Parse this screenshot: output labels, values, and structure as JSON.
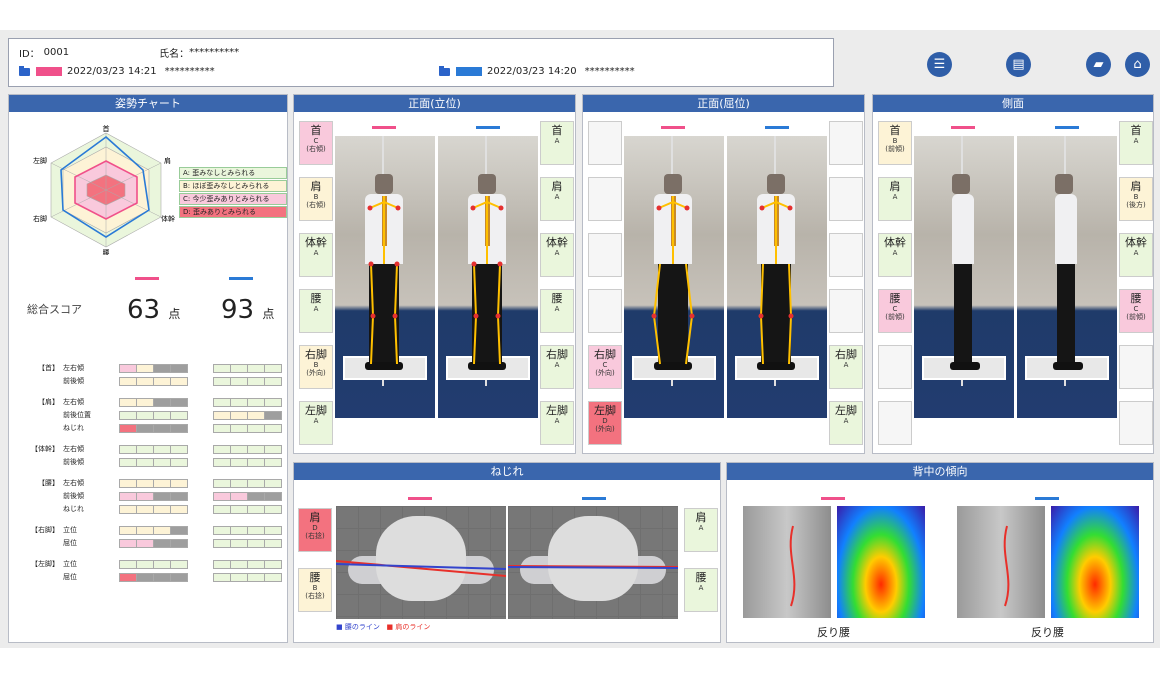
{
  "header": {
    "id_label": "ID：",
    "id_value": "0001",
    "name_label": "氏名：",
    "name_value": "**********",
    "session_a": {
      "date": "2022/03/23 14:21",
      "name": "**********",
      "color": "#f0508a"
    },
    "session_b": {
      "date": "2022/03/23 14:20",
      "name": "**********",
      "color": "#2a7ad6"
    }
  },
  "toolbar": {
    "report_icon": "report-icon",
    "print_icon": "print-icon",
    "folder_icon": "folder-icon",
    "home_icon": "home-icon"
  },
  "posture_chart": {
    "title": "姿勢チャート",
    "axes": [
      "首",
      "肩",
      "体幹",
      "腰",
      "右脚",
      "左脚"
    ],
    "legend": [
      "A: 歪みなしとみられる",
      "B: ほぼ歪みなしとみられる",
      "C: 今少歪みありとみられる",
      "D: 歪みありとみられる"
    ],
    "score_label": "総合スコア",
    "score_a": "63",
    "score_b": "93",
    "unit": "点",
    "groups": [
      {
        "cat": "【首】",
        "rows": [
          "左右傾",
          "前後傾"
        ]
      },
      {
        "cat": "【肩】",
        "rows": [
          "左右傾",
          "前後位置",
          "ねじれ"
        ]
      },
      {
        "cat": "【体幹】",
        "rows": [
          "左右傾",
          "前後傾"
        ]
      },
      {
        "cat": "【腰】",
        "rows": [
          "左右傾",
          "前後傾",
          "ねじれ"
        ]
      },
      {
        "cat": "【右脚】",
        "rows": [
          "立位",
          "屈位"
        ]
      },
      {
        "cat": "【左脚】",
        "rows": [
          "立位",
          "屈位"
        ]
      }
    ]
  },
  "front_standing": {
    "title": "正面(立位)",
    "left": [
      {
        "label": "首",
        "grade": "C",
        "note": "(右傾)"
      },
      {
        "label": "肩",
        "grade": "B",
        "note": "(右傾)"
      },
      {
        "label": "体幹",
        "grade": "A",
        "note": ""
      },
      {
        "label": "腰",
        "grade": "A",
        "note": ""
      },
      {
        "label": "右脚",
        "grade": "B",
        "note": "(外向)"
      },
      {
        "label": "左脚",
        "grade": "A",
        "note": ""
      }
    ],
    "right": [
      {
        "label": "首",
        "grade": "A"
      },
      {
        "label": "肩",
        "grade": "A"
      },
      {
        "label": "体幹",
        "grade": "A"
      },
      {
        "label": "腰",
        "grade": "A"
      },
      {
        "label": "右脚",
        "grade": "A"
      },
      {
        "label": "左脚",
        "grade": "A"
      }
    ]
  },
  "front_bending": {
    "title": "正面(屈位)",
    "left": [
      {
        "label": "右脚",
        "grade": "C",
        "note": "(外向)"
      },
      {
        "label": "左脚",
        "grade": "D",
        "note": "(外向)"
      }
    ],
    "right": [
      {
        "label": "右脚",
        "grade": "A"
      },
      {
        "label": "左脚",
        "grade": "A"
      }
    ]
  },
  "side": {
    "title": "側面",
    "left": [
      {
        "label": "首",
        "grade": "B",
        "note": "(前傾)"
      },
      {
        "label": "肩",
        "grade": "A",
        "note": ""
      },
      {
        "label": "体幹",
        "grade": "A",
        "note": ""
      },
      {
        "label": "腰",
        "grade": "C",
        "note": "(前傾)"
      }
    ],
    "right": [
      {
        "label": "首",
        "grade": "A",
        "note": ""
      },
      {
        "label": "肩",
        "grade": "B",
        "note": "(後方)"
      },
      {
        "label": "体幹",
        "grade": "A",
        "note": ""
      },
      {
        "label": "腰",
        "grade": "C",
        "note": "(前傾)"
      }
    ]
  },
  "twist": {
    "title": "ねじれ",
    "left": [
      {
        "label": "肩",
        "grade": "D",
        "note": "(右捻)"
      },
      {
        "label": "腰",
        "grade": "B",
        "note": "(右捻)"
      }
    ],
    "right": [
      {
        "label": "肩",
        "grade": "A"
      },
      {
        "label": "腰",
        "grade": "A"
      }
    ],
    "legend_waist": "■ 腰のライン",
    "legend_shoulder": "■ 肩のライン"
  },
  "back": {
    "title": "背中の傾向",
    "caption_a": "反り腰",
    "caption_b": "反り腰"
  },
  "colors": {
    "grade_a": "#eaf6dc",
    "grade_b": "#fdf3d6",
    "grade_c": "#f9c9dc",
    "grade_d": "#f3727f",
    "header_blue": "#3a66ad"
  }
}
